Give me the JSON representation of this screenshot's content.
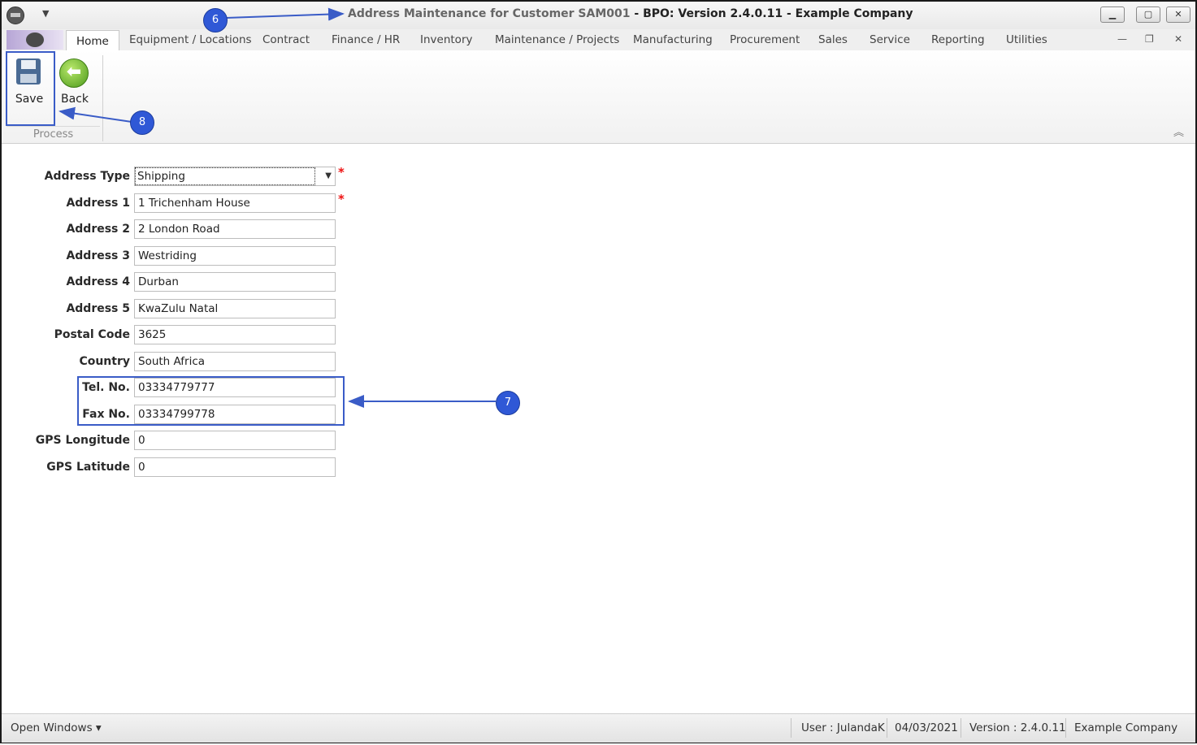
{
  "window": {
    "title_main": "Address Maintenance for Customer SAM001",
    "title_app": " - BPO: Version 2.4.0.11 - Example Company",
    "minimize": "▁",
    "maximize": "▢",
    "close": "✕"
  },
  "ribbon": {
    "tabs": [
      "Home",
      "Equipment / Locations",
      "Contract",
      "Finance / HR",
      "Inventory",
      "Maintenance / Projects",
      "Manufacturing",
      "Procurement",
      "Sales",
      "Service",
      "Reporting",
      "Utilities"
    ],
    "active_tab": "Home",
    "buttons": {
      "save": "Save",
      "back": "Back"
    },
    "group_label": "Process"
  },
  "form": {
    "address_type": {
      "label": "Address Type",
      "value": "Shipping"
    },
    "address1": {
      "label": "Address 1",
      "value": "1 Trichenham House"
    },
    "address2": {
      "label": "Address 2",
      "value": "2 London Road"
    },
    "address3": {
      "label": "Address 3",
      "value": "Westriding"
    },
    "address4": {
      "label": "Address 4",
      "value": "Durban"
    },
    "address5": {
      "label": "Address 5",
      "value": "KwaZulu Natal"
    },
    "postal_code": {
      "label": "Postal Code",
      "value": "3625"
    },
    "country": {
      "label": "Country",
      "value": "South Africa"
    },
    "tel_no": {
      "label": "Tel. No.",
      "value": "03334779777"
    },
    "fax_no": {
      "label": "Fax No.",
      "value": "03334799778"
    },
    "gps_longitude": {
      "label": "GPS Longitude",
      "value": "0"
    },
    "gps_latitude": {
      "label": "GPS Latitude",
      "value": "0"
    },
    "required_marker": "*"
  },
  "annotations": {
    "step7": "7",
    "step8": "8",
    "step6": "6"
  },
  "statusbar": {
    "open_windows": "Open Windows ▾",
    "user": "User : JulandaK",
    "date": "04/03/2021",
    "version": "Version : 2.4.0.11",
    "company": "Example Company"
  },
  "colors": {
    "annotation": "#2f58d6",
    "required": "#e11111"
  }
}
